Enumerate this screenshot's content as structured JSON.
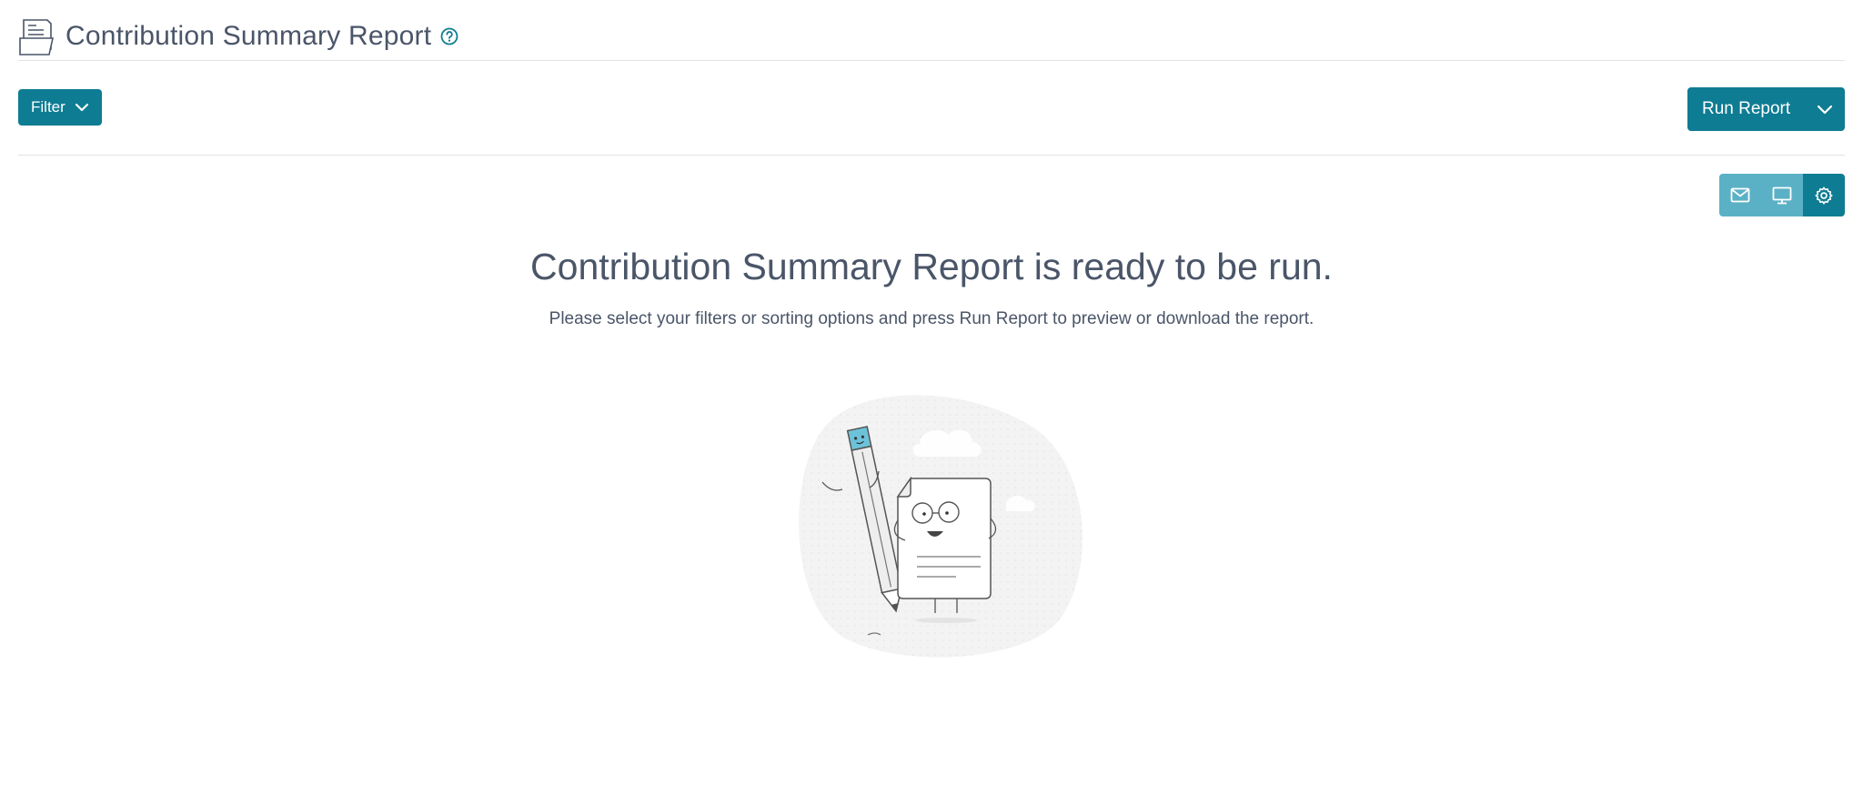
{
  "header": {
    "title": "Contribution Summary Report",
    "icons": {
      "page": "report-pages-icon",
      "help": "question-circle-icon"
    }
  },
  "toolbar": {
    "filter_label": "Filter",
    "run_label": "Run Report"
  },
  "view_options": {
    "items": [
      {
        "icon": "envelope-icon",
        "active": false
      },
      {
        "icon": "monitor-icon",
        "active": false
      },
      {
        "icon": "gear-icon",
        "active": true
      }
    ]
  },
  "main": {
    "title": "Contribution Summary Report is ready to be run.",
    "subtitle": "Please select your filters or sorting options and press Run Report to preview or download the report."
  },
  "colors": {
    "primary": "#0e7c93",
    "primary_light": "#5ab1c5",
    "text": "#4a5568",
    "divider": "#dfe3e7"
  }
}
